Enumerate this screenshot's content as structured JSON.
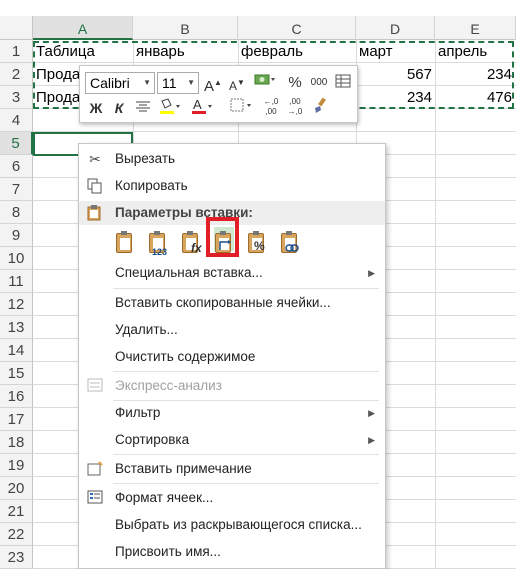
{
  "columns": [
    "A",
    "B",
    "C",
    "D",
    "E"
  ],
  "rows": [
    "1",
    "2",
    "3",
    "4",
    "5",
    "6",
    "7",
    "8",
    "9",
    "10",
    "11",
    "12",
    "13",
    "14",
    "15",
    "16",
    "17",
    "18",
    "19",
    "20",
    "21",
    "22",
    "23"
  ],
  "cells": {
    "a1": "Таблица",
    "b1": "январь",
    "c1": "февраль",
    "d1": "март",
    "e1": "апрель",
    "a2": "Прода",
    "d2": "567",
    "e2": "234",
    "a3": "Прода",
    "d3": "234",
    "e3": "476"
  },
  "mini_toolbar": {
    "font": "Calibri",
    "size": "11",
    "grow": "A",
    "shrink": "A",
    "percent": "%",
    "thousands": "000",
    "bold": "Ж",
    "italic": "К",
    "decimals_up": "←,0 ,00",
    "decimals_down": ",00 →,0",
    "font_color": "#e21e26",
    "fill_color": "#ffff00"
  },
  "menu": {
    "cut": "Вырезать",
    "copy": "Копировать",
    "paste_options": "Параметры вставки:",
    "paste_badges": {
      "values": "123",
      "formula": "fx",
      "percent": "%"
    },
    "paste_special": "Специальная вставка...",
    "insert_copied": "Вставить скопированные ячейки...",
    "delete": "Удалить...",
    "clear": "Очистить содержимое",
    "quick_analysis": "Экспресс-анализ",
    "filter": "Фильтр",
    "sort": "Сортировка",
    "insert_comment": "Вставить примечание",
    "format_cells": "Формат ячеек...",
    "pick_list": "Выбрать из раскрывающегося списка...",
    "define_name": "Присвоить имя..."
  },
  "colors": {
    "accent": "#217346",
    "highlight_frame": "#e21e26"
  }
}
